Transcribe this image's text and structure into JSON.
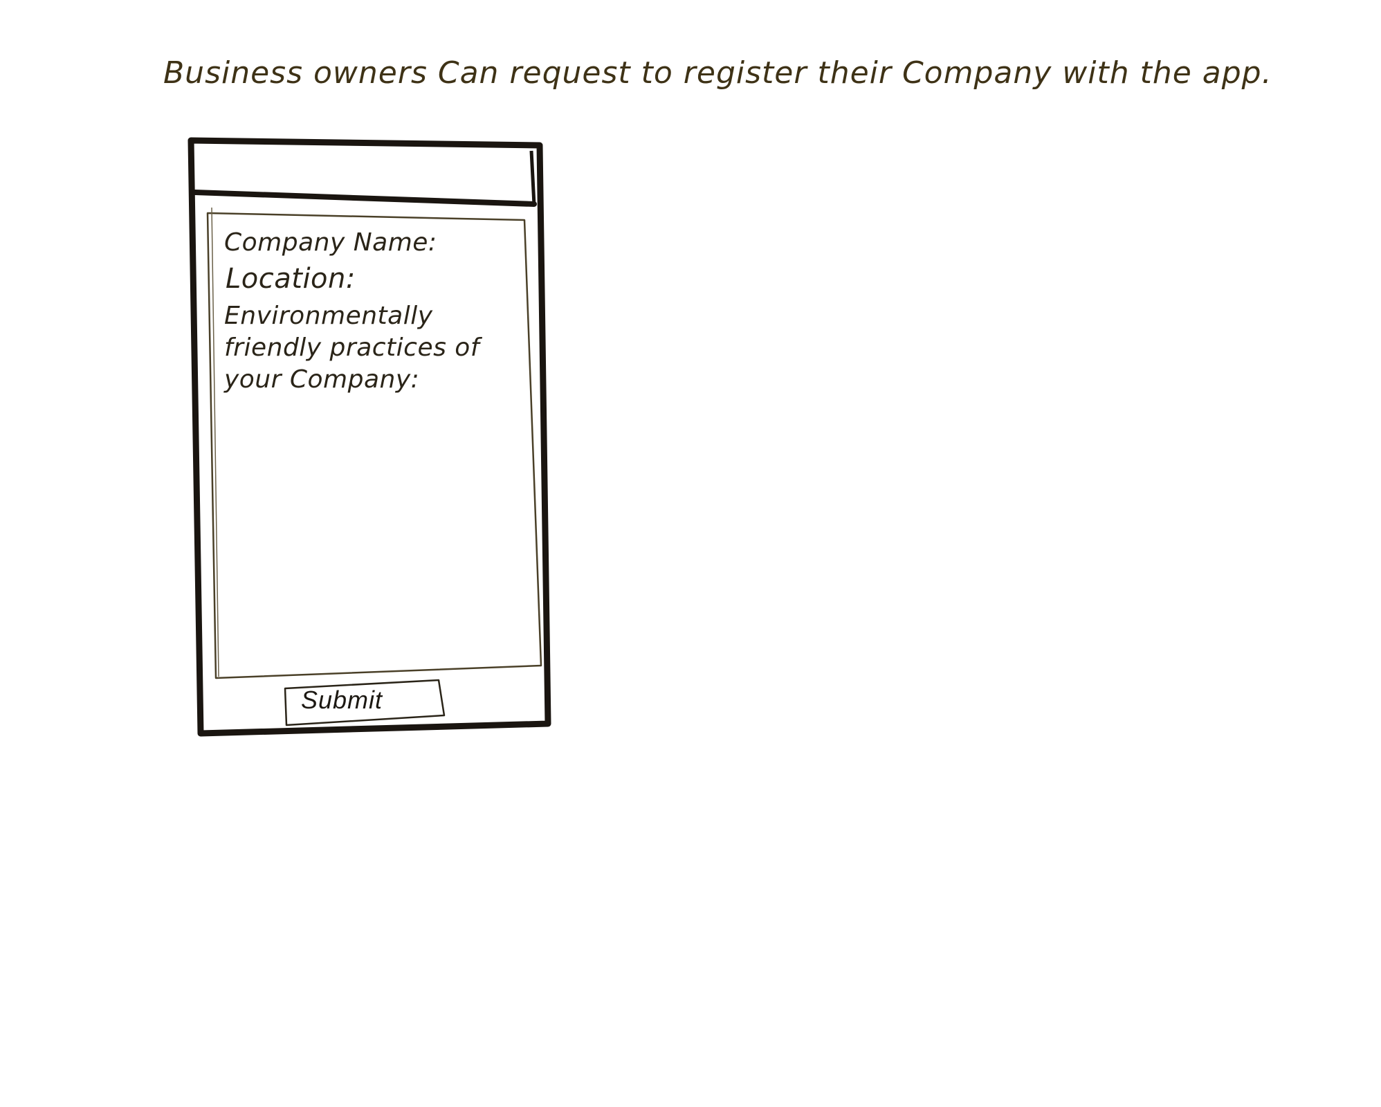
{
  "caption": "Business owners Can request to register their Company with the app.",
  "form": {
    "company_name_label": "Company Name:",
    "location_label": "Location:",
    "practices_label": "Environmentally friendly practices of your Company:",
    "submit_label": "Submit"
  },
  "colors": {
    "ink": "#1c1812",
    "caption_ink": "#3e3216",
    "paper": "#ffffff"
  }
}
